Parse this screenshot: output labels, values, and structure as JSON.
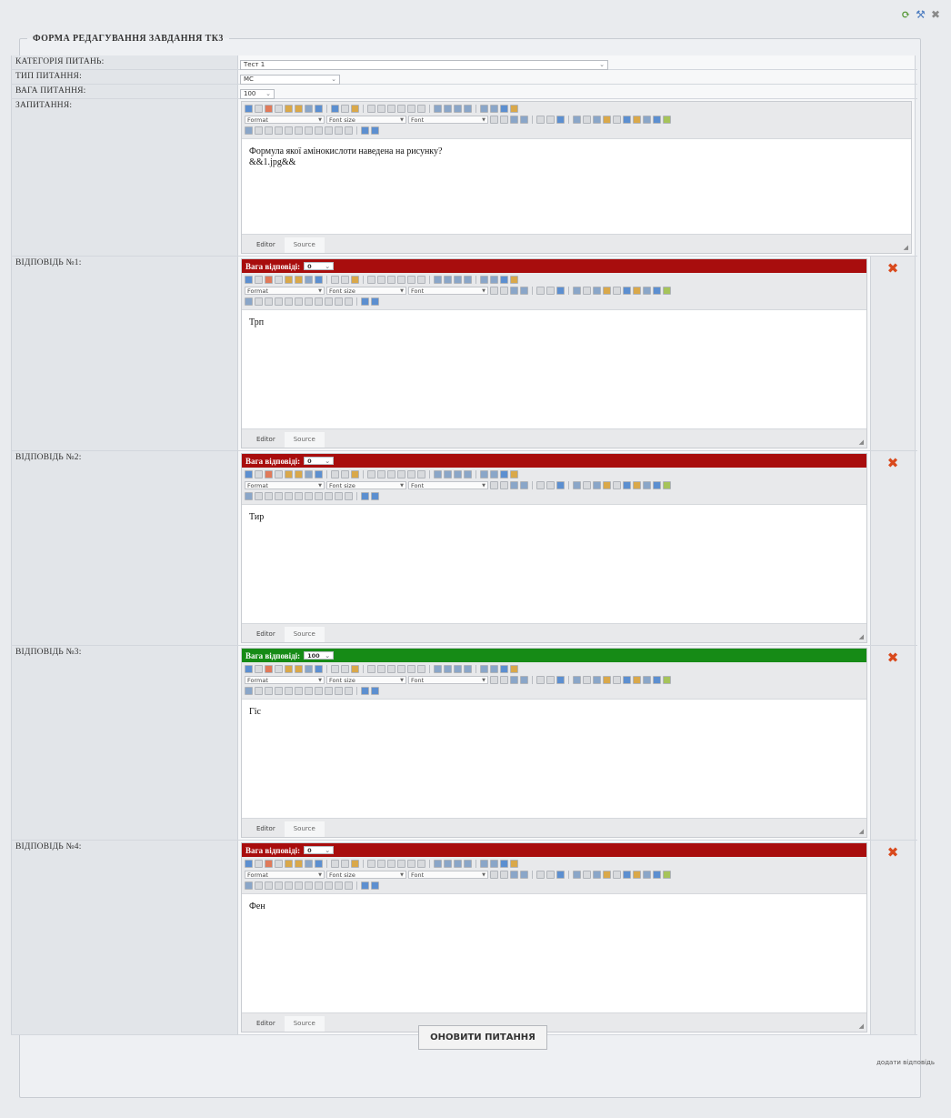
{
  "window_icons": {
    "refresh": "refresh-icon",
    "tools": "tools-icon",
    "close": "close-icon"
  },
  "form": {
    "legend": "ФОРМА РЕДАГУВАННЯ ЗАВДАННЯ ТК3",
    "category": {
      "label": "КАТЕГОРІЯ ПИТАНЬ:",
      "value": "Тест 1"
    },
    "type": {
      "label": "ТИП ПИТАННЯ:",
      "value": "MC"
    },
    "weight": {
      "label": "ВАГА ПИТАННЯ:",
      "value": "100"
    },
    "question": {
      "label": "ЗАПИТАННЯ:",
      "line1": "Формула якої амінокислоти наведена на рисунку?",
      "line2": "&&1.jpg&&"
    }
  },
  "editor": {
    "format_label": "Format",
    "font_size_label": "Font size",
    "font_label": "Font",
    "tab_editor": "Editor",
    "tab_source": "Source"
  },
  "answers": [
    {
      "label": "ВІДПОВІДЬ №1:",
      "weight_label": "Вага відповіді:",
      "weight": "0",
      "text": "Трп",
      "status_color": "#a80d0d"
    },
    {
      "label": "ВІДПОВІДЬ №2:",
      "weight_label": "Вага відповіді:",
      "weight": "0",
      "text": "Тир",
      "status_color": "#a80d0d"
    },
    {
      "label": "ВІДПОВІДЬ №3:",
      "weight_label": "Вага відповіді:",
      "weight": "100",
      "text": "Гіс",
      "status_color": "#168b16"
    },
    {
      "label": "ВІДПОВІДЬ №4:",
      "weight_label": "Вага відповіді:",
      "weight": "0",
      "text": "Фен",
      "status_color": "#a80d0d"
    }
  ],
  "actions": {
    "add_answer": "додати відповідь",
    "update": "ОНОВИТИ ПИТАННЯ"
  }
}
